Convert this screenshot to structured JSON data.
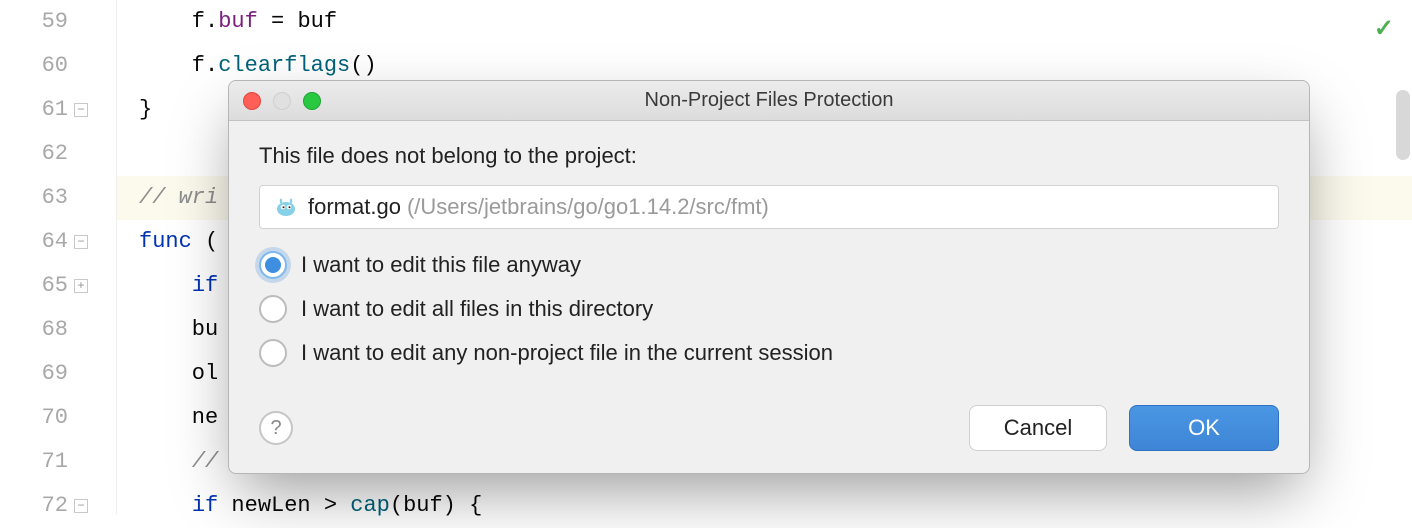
{
  "editor": {
    "lines": [
      {
        "n": "59",
        "html": "    f.<span class=\"c-field\">buf</span> = <span class=\"c-ident\">buf</span>"
      },
      {
        "n": "60",
        "html": "    f.<span class=\"c-call\">clearflags</span>()"
      },
      {
        "n": "61",
        "html": "}",
        "fold": "-"
      },
      {
        "n": "62",
        "html": ""
      },
      {
        "n": "63",
        "html": "<span class=\"c-comment\">// wri</span>",
        "highlight": true
      },
      {
        "n": "64",
        "html": "<span class=\"c-kw\">func</span> (",
        "fold": "-"
      },
      {
        "n": "65",
        "html": "    <span class=\"c-kw\">if</span>",
        "fold": "+"
      },
      {
        "n": "68",
        "html": "    bu"
      },
      {
        "n": "69",
        "html": "    ol"
      },
      {
        "n": "70",
        "html": "    ne"
      },
      {
        "n": "71",
        "html": "    <span class=\"c-comment\">//</span>"
      },
      {
        "n": "72",
        "html": "    <span class=\"c-kw\">if</span> <span class=\"c-ident\">newLen</span> > <span class=\"c-call\">cap</span>(<span class=\"c-ident\">buf</span>) {",
        "fold": "-"
      }
    ]
  },
  "dialog": {
    "title": "Non-Project Files Protection",
    "prompt": "This file does not belong to the project:",
    "file": {
      "name": "format.go",
      "path": "(/Users/jetbrains/go/go1.14.2/src/fmt)"
    },
    "options": [
      {
        "label": "I want to edit this file anyway",
        "selected": true
      },
      {
        "label": "I want to edit all files in this directory",
        "selected": false
      },
      {
        "label": "I want to edit any non-project file in the current session",
        "selected": false
      }
    ],
    "buttons": {
      "cancel": "Cancel",
      "ok": "OK"
    }
  }
}
